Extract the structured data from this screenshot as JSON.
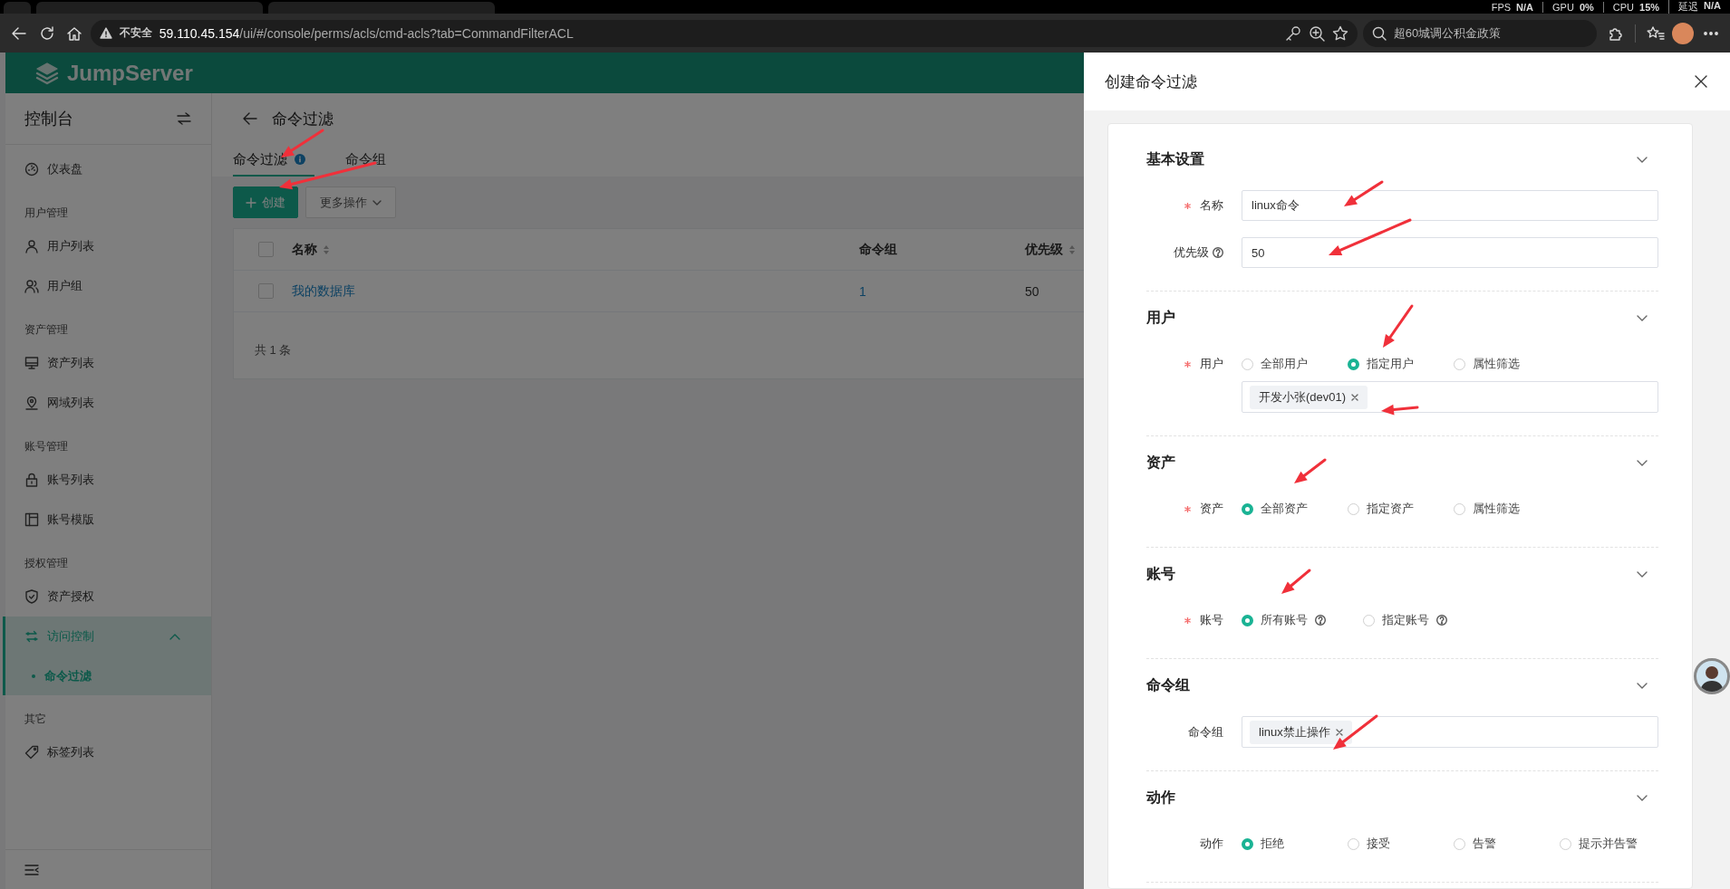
{
  "browser": {
    "stats": [
      {
        "label": "FPS",
        "value": "N/A"
      },
      {
        "label": "GPU",
        "value": "0%"
      },
      {
        "label": "CPU",
        "value": "15%"
      },
      {
        "label": "延迟",
        "value": "N/A"
      }
    ],
    "security": "不安全",
    "url_host": "59.110.45.154",
    "url_path": "/ui/#/console/perms/acls/cmd-acls?tab=CommandFilterACL",
    "search": "超60城调公积金政策"
  },
  "app": {
    "logo": "JumpServer"
  },
  "sidebar": {
    "title": "控制台",
    "items": [
      {
        "kind": "item",
        "label": "仪表盘",
        "selected": false
      },
      {
        "kind": "group",
        "label": "用户管理"
      },
      {
        "kind": "item",
        "label": "用户列表",
        "selected": false
      },
      {
        "kind": "item",
        "label": "用户组",
        "selected": false
      },
      {
        "kind": "group",
        "label": "资产管理"
      },
      {
        "kind": "item",
        "label": "资产列表",
        "selected": false
      },
      {
        "kind": "item",
        "label": "网域列表",
        "selected": false
      },
      {
        "kind": "group",
        "label": "账号管理"
      },
      {
        "kind": "item",
        "label": "账号列表",
        "selected": false
      },
      {
        "kind": "item",
        "label": "账号模版",
        "selected": false
      },
      {
        "kind": "group",
        "label": "授权管理"
      },
      {
        "kind": "item",
        "label": "资产授权",
        "selected": false
      },
      {
        "kind": "item",
        "label": "访问控制",
        "selected": false,
        "expanded": true,
        "children": [
          {
            "label": "命令过滤",
            "selected": true
          }
        ]
      },
      {
        "kind": "group",
        "label": "其它"
      },
      {
        "kind": "item",
        "label": "标签列表",
        "selected": false
      }
    ]
  },
  "page": {
    "title": "命令过滤",
    "tabs": [
      {
        "label": "命令过滤",
        "selected": true,
        "info": true
      },
      {
        "label": "命令组",
        "selected": false
      }
    ],
    "buttons": [
      {
        "kind": "primary",
        "label": "创建"
      },
      {
        "kind": "dropdown",
        "label": "更多操作"
      }
    ],
    "table": {
      "all_checked": false,
      "columns": [
        {
          "label": "名称",
          "sortable": true
        },
        {
          "label": "命令组"
        },
        {
          "label": "优先级",
          "sortable": true
        }
      ],
      "rows": [
        {
          "checked": false,
          "cells": [
            {
              "kind": "link",
              "text": "我的数据库"
            },
            {
              "kind": "link",
              "text": "1"
            },
            {
              "kind": "text",
              "text": "50"
            }
          ]
        }
      ],
      "footer": "共 1 条"
    }
  },
  "drawer": {
    "title": "创建命令过滤",
    "sections": [
      {
        "title": "基本设置",
        "fields": [
          {
            "kind": "input",
            "label": "名称",
            "required": true,
            "value": "linux命令"
          },
          {
            "kind": "input",
            "label": "优先级",
            "help": true,
            "value": "50"
          }
        ]
      },
      {
        "title": "用户",
        "fields": [
          {
            "kind": "radio",
            "label": "用户",
            "required": true,
            "options": [
              {
                "label": "全部用户",
                "selected": false
              },
              {
                "label": "指定用户",
                "selected": true
              },
              {
                "label": "属性筛选",
                "selected": false
              }
            ]
          },
          {
            "kind": "tags",
            "tags": [
              "开发小张(dev01)"
            ]
          }
        ]
      },
      {
        "title": "资产",
        "fields": [
          {
            "kind": "radio",
            "label": "资产",
            "required": true,
            "options": [
              {
                "label": "全部资产",
                "selected": true
              },
              {
                "label": "指定资产",
                "selected": false
              },
              {
                "label": "属性筛选",
                "selected": false
              }
            ]
          }
        ]
      },
      {
        "title": "账号",
        "fields": [
          {
            "kind": "radio",
            "label": "账号",
            "required": true,
            "options": [
              {
                "label": "所有账号",
                "selected": true,
                "help": true
              },
              {
                "label": "指定账号",
                "selected": false,
                "help": true
              }
            ]
          }
        ]
      },
      {
        "title": "命令组",
        "fields": [
          {
            "kind": "tags",
            "label": "命令组",
            "tags": [
              "linux禁止操作"
            ]
          }
        ]
      },
      {
        "title": "动作",
        "fields": [
          {
            "kind": "radio",
            "label": "动作",
            "options": [
              {
                "label": "拒绝",
                "selected": true
              },
              {
                "label": "接受",
                "selected": false
              },
              {
                "label": "告警",
                "selected": false
              },
              {
                "label": "提示并告警",
                "selected": false
              }
            ]
          }
        ]
      }
    ]
  }
}
